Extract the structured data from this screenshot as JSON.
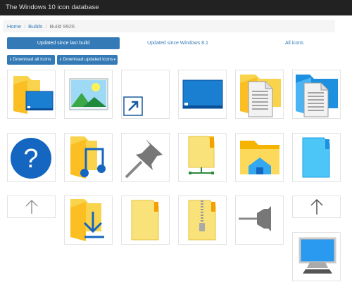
{
  "app": {
    "title": "The Windows 10 icon database"
  },
  "breadcrumb": {
    "home": "Home",
    "builds": "Builds",
    "current": "Build 9926"
  },
  "tabs": {
    "since_last": "Updated since last build",
    "since_81": "Updated since Windows 8.1",
    "all": "All icons"
  },
  "actions": {
    "download_all": "Download all icons",
    "download_updated": "Download updated icons",
    "download_icon": "download-icon",
    "caret_icon": "caret-down-icon"
  },
  "icons": [
    {
      "name": "folder-desktop-icon"
    },
    {
      "name": "pictures-landscape-icon"
    },
    {
      "name": "shortcut-arrow-icon"
    },
    {
      "name": "desktop-window-icon"
    },
    {
      "name": "folder-document-icon"
    },
    {
      "name": "documents-folder-blue-icon"
    },
    {
      "name": "help-question-icon"
    },
    {
      "name": "music-folder-icon"
    },
    {
      "name": "pin-icon"
    },
    {
      "name": "network-folder-icon"
    },
    {
      "name": "home-folder-icon"
    },
    {
      "name": "blue-folder-icon"
    },
    {
      "name": "up-arrow-icon"
    },
    {
      "name": "downloads-folder-icon"
    },
    {
      "name": "generic-folder-icon"
    },
    {
      "name": "zip-folder-icon"
    },
    {
      "name": "pin-sideways-icon"
    },
    {
      "name": "up-arrow-large-icon"
    },
    {
      "name": "computer-monitor-icon"
    }
  ],
  "colors": {
    "primary": "#337ab7",
    "navbar": "#222222",
    "folder": "#f9d34b"
  }
}
